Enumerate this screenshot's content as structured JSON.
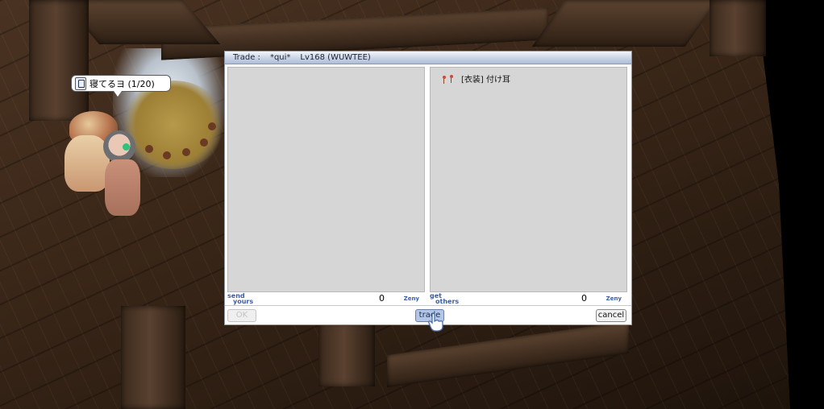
{
  "chat": {
    "text": "寝てるヨ (1/20)",
    "icon": "chatroom-door-icon"
  },
  "trade_window": {
    "title_label": "Trade :",
    "partner_name": "*qui*",
    "partner_info": "Lv168 (WUWTEE)",
    "my_side": {
      "label_line1": "send",
      "label_line2": "yours",
      "zeny": "0",
      "zeny_unit": "Zeny",
      "items": []
    },
    "their_side": {
      "label_line1": "get",
      "label_line2": "others",
      "zeny": "0",
      "zeny_unit": "Zeny",
      "items": [
        {
          "name": "[衣装] 付け耳",
          "icon": "costume-ears-icon"
        }
      ]
    },
    "buttons": {
      "ok": "OK",
      "trade": "trade",
      "cancel": "cancel"
    }
  },
  "colors": {
    "title_gradient_end": "#aebcd6",
    "pane_bg": "#d6d6d6",
    "label_blue": "#3c5ea0",
    "trade_button_bg": "#b3c6e6"
  }
}
